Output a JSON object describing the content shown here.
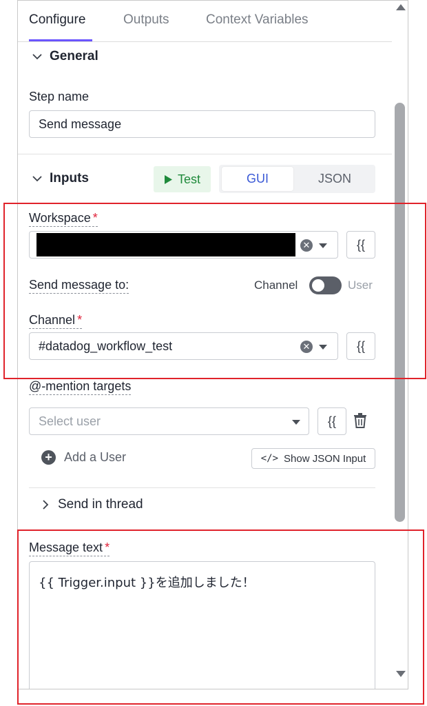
{
  "tabs": [
    {
      "label": "Configure",
      "active": true
    },
    {
      "label": "Outputs",
      "active": false
    },
    {
      "label": "Context Variables",
      "active": false
    }
  ],
  "general": {
    "header": "General",
    "step_name_label": "Step name",
    "step_name_value": "Send message"
  },
  "inputs": {
    "header": "Inputs",
    "test_label": "Test",
    "mode_options": [
      "GUI",
      "JSON"
    ],
    "mode_selected": "GUI",
    "workspace_label": "Workspace",
    "required_mark": "*",
    "template_button_label": "{{",
    "send_to_label": "Send message to:",
    "send_to_option_left": "Channel",
    "send_to_option_right": "User",
    "channel_label": "Channel",
    "channel_value": "#datadog_workflow_test",
    "mentions_label": "@-mention targets",
    "mentions_placeholder": "Select user",
    "add_user_label": "Add a User",
    "show_json_label": "Show JSON Input",
    "send_in_thread_label": "Send in thread",
    "message_text_label": "Message text",
    "message_text_value": "{{ Trigger.input }}を追加しました！"
  },
  "colors": {
    "accent": "#6a55ff",
    "required": "#e0223a",
    "test_green": "#1f8a3b",
    "highlight_red": "#e0222a"
  }
}
